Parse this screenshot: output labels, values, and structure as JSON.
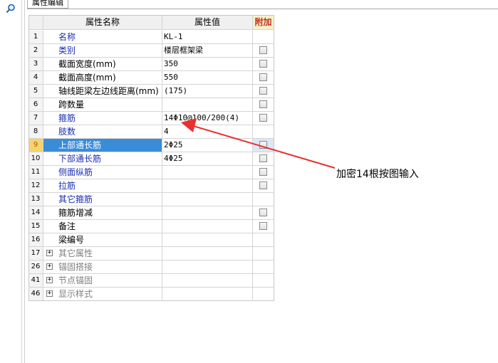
{
  "tab": {
    "title": "属性编辑"
  },
  "icons": {
    "search": "magnifier-icon",
    "expand": "plus-expander-icon",
    "checkbox": "checkbox-icon"
  },
  "table": {
    "headers": {
      "name": "属性名称",
      "value": "属性值",
      "extra": "附加"
    },
    "rows": [
      {
        "num": "1",
        "name": "名称",
        "value": "KL-1",
        "checkbox": false,
        "style": "blue"
      },
      {
        "num": "2",
        "name": "类别",
        "value": "楼层框架梁",
        "checkbox": true,
        "style": "blue"
      },
      {
        "num": "3",
        "name": "截面宽度(mm)",
        "value": "350",
        "checkbox": true,
        "style": "black"
      },
      {
        "num": "4",
        "name": "截面高度(mm)",
        "value": "550",
        "checkbox": true,
        "style": "black"
      },
      {
        "num": "5",
        "name": "轴线距梁左边线距离(mm)",
        "value": "(175)",
        "checkbox": true,
        "style": "black"
      },
      {
        "num": "6",
        "name": "跨数量",
        "value": "",
        "checkbox": true,
        "style": "black"
      },
      {
        "num": "7",
        "name": "箍筋",
        "value": "14Φ10@100/200(4)",
        "checkbox": true,
        "style": "blue"
      },
      {
        "num": "8",
        "name": "肢数",
        "value": "4",
        "checkbox": false,
        "style": "blue"
      },
      {
        "num": "9",
        "name": "上部通长筋",
        "value": "2Φ25",
        "checkbox": true,
        "style": "blue",
        "selected": true
      },
      {
        "num": "10",
        "name": "下部通长筋",
        "value": "4Φ25",
        "checkbox": true,
        "style": "blue"
      },
      {
        "num": "11",
        "name": "侧面纵筋",
        "value": "",
        "checkbox": true,
        "style": "blue"
      },
      {
        "num": "12",
        "name": "拉筋",
        "value": "",
        "checkbox": true,
        "style": "blue"
      },
      {
        "num": "13",
        "name": "其它箍筋",
        "value": "",
        "checkbox": false,
        "style": "blue"
      },
      {
        "num": "14",
        "name": "箍筋增减",
        "value": "",
        "checkbox": true,
        "style": "black"
      },
      {
        "num": "15",
        "name": "备注",
        "value": "",
        "checkbox": true,
        "style": "black"
      },
      {
        "num": "16",
        "name": "梁编号",
        "value": "",
        "checkbox": false,
        "style": "black"
      },
      {
        "num": "17",
        "name": "其它属性",
        "value": "",
        "checkbox": false,
        "style": "gray",
        "group": true
      },
      {
        "num": "26",
        "name": "锚固搭接",
        "value": "",
        "checkbox": false,
        "style": "gray",
        "group": true
      },
      {
        "num": "41",
        "name": "节点锚固",
        "value": "",
        "checkbox": false,
        "style": "gray",
        "group": true
      },
      {
        "num": "46",
        "name": "显示样式",
        "value": "",
        "checkbox": false,
        "style": "gray",
        "group": true
      }
    ]
  },
  "annotation": {
    "text": "加密14根按图输入",
    "color": "#e8312f"
  }
}
